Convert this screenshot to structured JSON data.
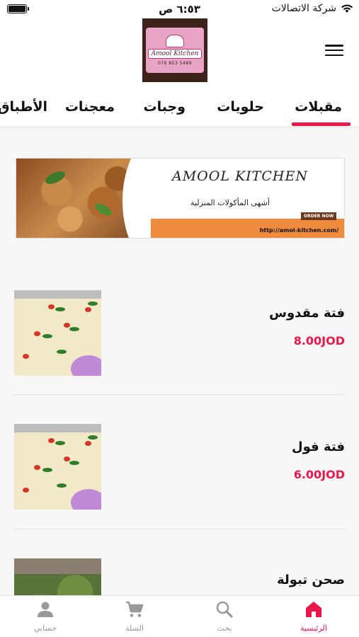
{
  "status_bar": {
    "carrier": "شركة الاتصالات",
    "time": "٦:٥٣ ص"
  },
  "header": {
    "logo_name": "Amool Kitchen",
    "logo_phone": "079 853 5489"
  },
  "tabs": [
    {
      "label": "مقبلات",
      "active": true
    },
    {
      "label": "حلويات",
      "active": false
    },
    {
      "label": "وجبات",
      "active": false
    },
    {
      "label": "معجنات",
      "active": false
    },
    {
      "label": "الأطباق",
      "active": false
    }
  ],
  "banner": {
    "title": "AMOOL KITCHEN",
    "subtitle": "أشهى المأكولات المنزلية",
    "order_label": "ORDER NOW",
    "url": "http://amol-kitchen.com/"
  },
  "products": [
    {
      "name": "فتة مقدوس",
      "price": "8.00JOD",
      "image": "fatteh"
    },
    {
      "name": "فتة فول",
      "price": "6.00JOD",
      "image": "fatteh"
    },
    {
      "name": "صحن تبولة",
      "price": "",
      "image": "tabbouleh"
    }
  ],
  "bottom_nav": [
    {
      "label": "الرئيسية",
      "icon": "home-icon",
      "active": true
    },
    {
      "label": "بحث",
      "icon": "search-icon",
      "active": false
    },
    {
      "label": "السلة",
      "icon": "cart-icon",
      "active": false
    },
    {
      "label": "حسابي",
      "icon": "person-icon",
      "active": false
    }
  ],
  "colors": {
    "accent": "#e8194a",
    "inactive": "#999999"
  }
}
